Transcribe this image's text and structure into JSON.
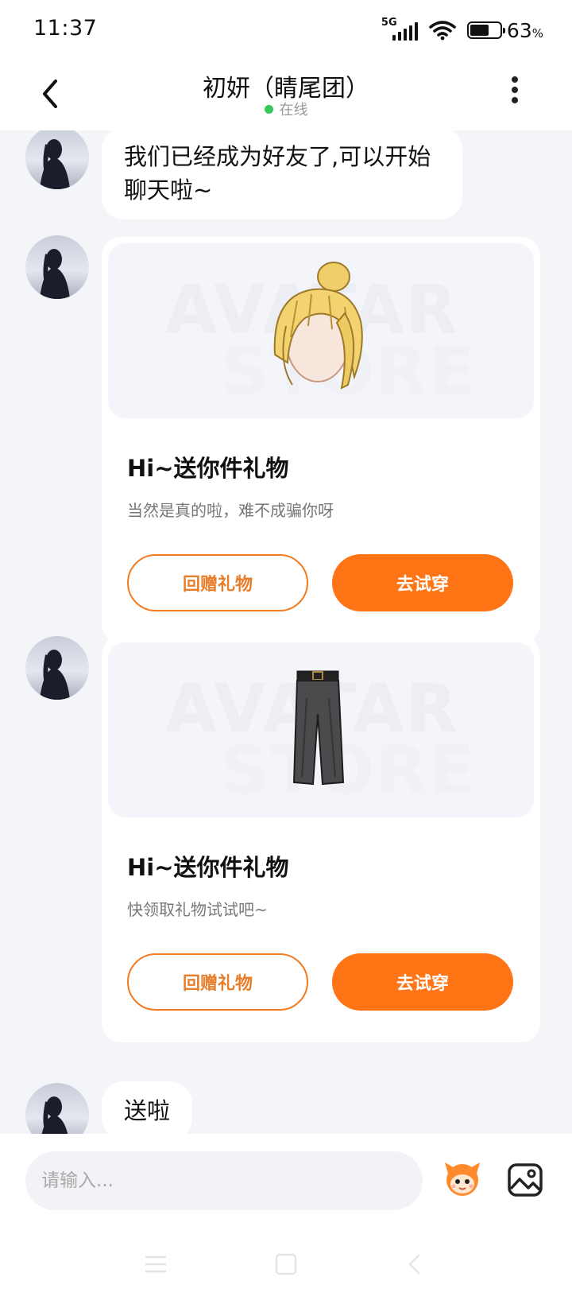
{
  "status_bar": {
    "time": "11:37",
    "network": "5G",
    "battery_percent": "63",
    "battery_unit": "%",
    "battery_level": 0.63
  },
  "header": {
    "back_icon": "chevron-left-icon",
    "title": "初妍（睛尾团）",
    "status_text": "在线",
    "status_color": "#34c759",
    "more_icon": "vertical-dots-icon"
  },
  "messages": [
    {
      "type": "text",
      "lines": [
        "我们已经成为好友了,可以开始",
        "聊天啦~"
      ]
    },
    {
      "type": "gift",
      "image": "blonde-hair-bun-item",
      "watermark_line1": "AVATAR",
      "watermark_line2": "STORE",
      "title": "Hi~送你件礼物",
      "subtitle": "当然是真的啦，难不成骗你呀",
      "return_label": "回赠礼物",
      "try_label": "去试穿"
    },
    {
      "type": "gift",
      "image": "dark-wide-leg-pants-item",
      "watermark_line1": "AVATAR",
      "watermark_line2": "STORE",
      "title": "Hi~送你件礼物",
      "subtitle": "快领取礼物试试吧~",
      "return_label": "回赠礼物",
      "try_label": "去试穿"
    },
    {
      "type": "text",
      "lines": [
        "送啦"
      ]
    }
  ],
  "input_bar": {
    "placeholder": "请输入...",
    "emoji_icon": "mascot-face-icon",
    "image_icon": "image-picker-icon"
  },
  "colors": {
    "accent": "#ff7415",
    "accent_outline": "#f37b1f",
    "background": "#f4f5f9"
  }
}
